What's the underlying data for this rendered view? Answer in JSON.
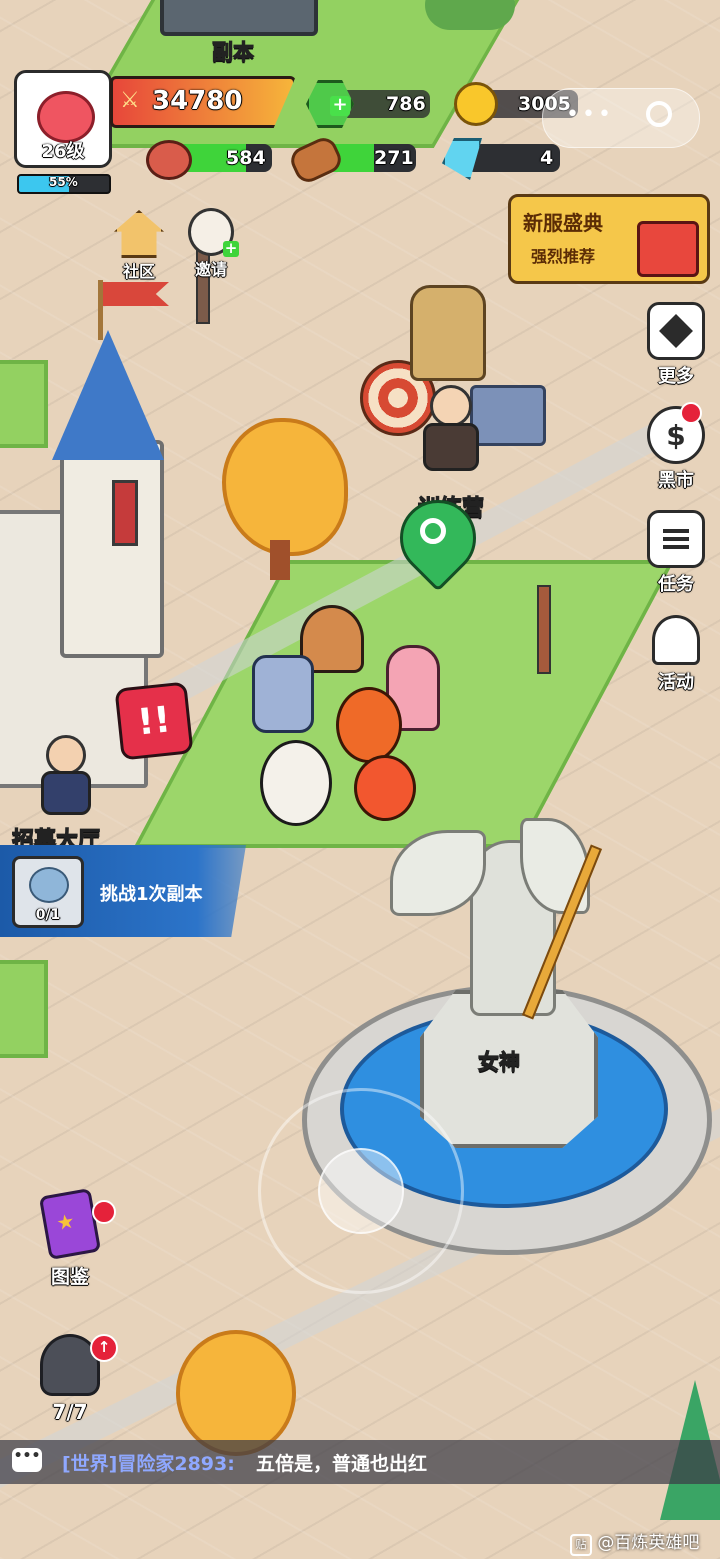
{
  "top": {
    "dungeon_label": "副本"
  },
  "player": {
    "level": "26级",
    "xp_percent_text": "55%",
    "xp_fraction": 0.55,
    "power": "34780"
  },
  "resources": {
    "gems": "786",
    "gold": "3005",
    "meat": "584",
    "wood": "271",
    "crystal": "4",
    "meat_fraction": 0.72,
    "wood_fraction": 0.55
  },
  "shortcuts": {
    "community": "社区",
    "invite": "邀请"
  },
  "promo": {
    "title": "新服盛典",
    "subtitle": "强烈推荐"
  },
  "side_menu": {
    "more": "更多",
    "black_market": "黑市",
    "tasks": "任务",
    "events": "活动"
  },
  "map_labels": {
    "training_camp": "训练营",
    "recruit_hall": "招募大厅",
    "goddess": "女神"
  },
  "quest": {
    "text": "挑战1次副本",
    "progress": "0/1"
  },
  "bottom_left": {
    "codex": "图鉴",
    "heroes": "7/7"
  },
  "chat": {
    "channel": "[世界]冒险家2893:",
    "message": "五倍是，普通也出红"
  },
  "watermark": "@百炼英雄吧",
  "colors": {
    "power_bar": "#e94a36",
    "xp_bar": "#3cc7ef",
    "resource_bar": "#3fd43a",
    "quest_panel": "#1f63b6"
  }
}
